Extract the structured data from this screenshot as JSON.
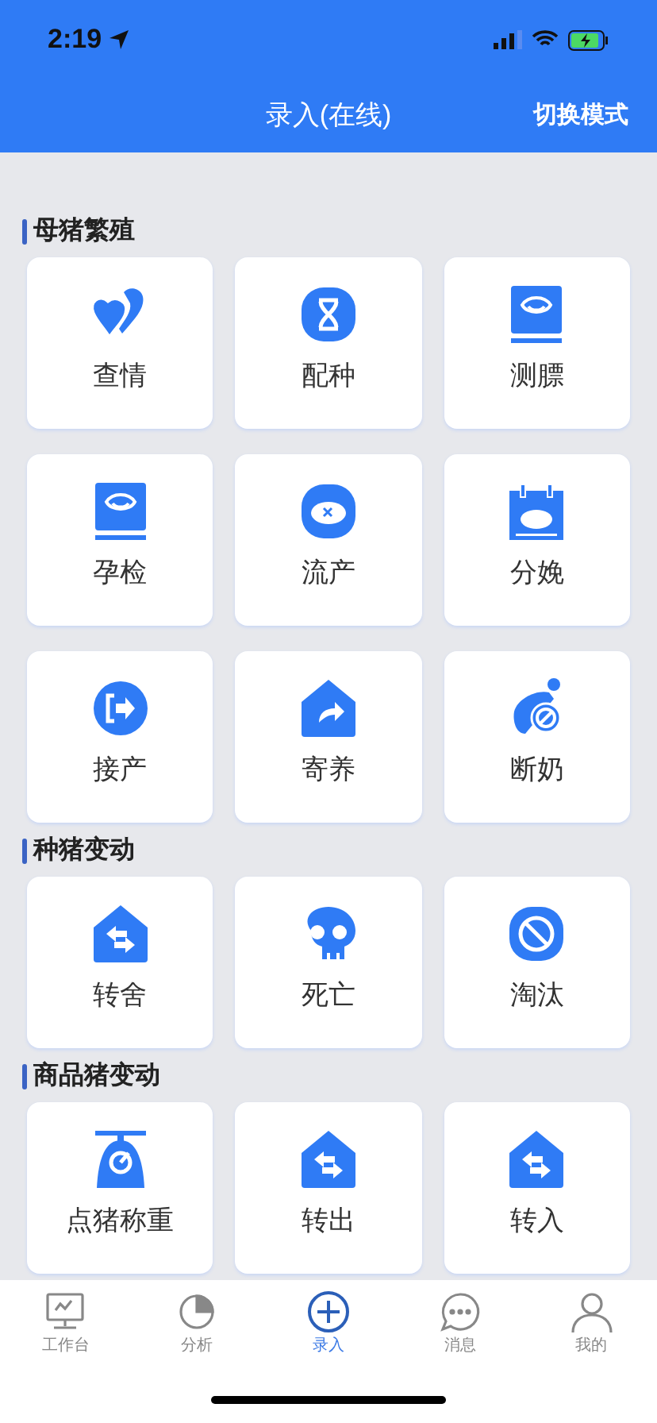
{
  "status_bar": {
    "time": "2:19"
  },
  "header": {
    "title": "录入(在线)",
    "action": "切换模式"
  },
  "sections": [
    {
      "title": "母猪繁殖",
      "tiles": [
        {
          "label": "查情",
          "kind": "hearts"
        },
        {
          "label": "配种",
          "kind": "dna"
        },
        {
          "label": "测膘",
          "kind": "ultrasound"
        },
        {
          "label": "孕检",
          "kind": "ultrasound"
        },
        {
          "label": "流产",
          "kind": "pig"
        },
        {
          "label": "分娩",
          "kind": "calendar"
        },
        {
          "label": "接产",
          "kind": "exit"
        },
        {
          "label": "寄养",
          "kind": "house-share"
        },
        {
          "label": "断奶",
          "kind": "bottle-ban"
        }
      ]
    },
    {
      "title": "种猪变动",
      "tiles": [
        {
          "label": "转舍",
          "kind": "house-swap"
        },
        {
          "label": "死亡",
          "kind": "skull"
        },
        {
          "label": "淘汰",
          "kind": "ban"
        }
      ]
    },
    {
      "title": "商品猪变动",
      "tiles": [
        {
          "label": "点猪称重",
          "kind": "scale"
        },
        {
          "label": "转出",
          "kind": "house-swap"
        },
        {
          "label": "转入",
          "kind": "house-swap"
        }
      ]
    }
  ],
  "tab_bar": [
    {
      "label": "工作台",
      "kind": "monitor",
      "selected": false
    },
    {
      "label": "分析",
      "kind": "pie",
      "selected": false
    },
    {
      "label": "录入",
      "kind": "plus",
      "selected": true
    },
    {
      "label": "消息",
      "kind": "chat",
      "selected": false
    },
    {
      "label": "我的",
      "kind": "person",
      "selected": false
    }
  ]
}
